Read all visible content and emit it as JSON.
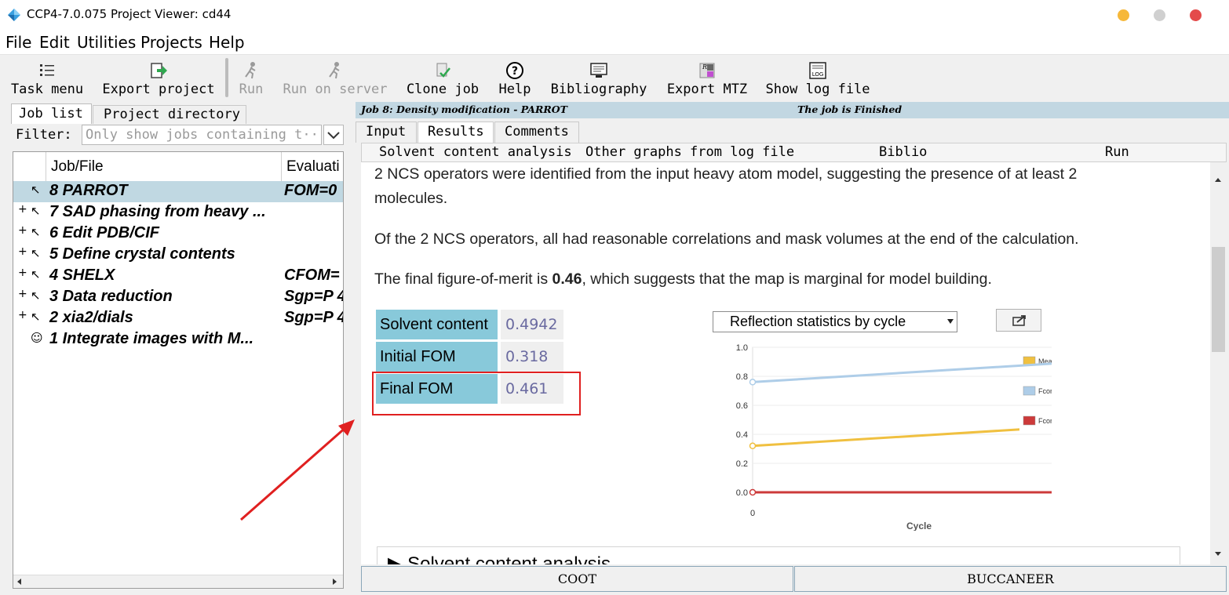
{
  "window": {
    "title": "CCP4-7.0.075 Project Viewer: cd44",
    "controls": {
      "minimize_color": "#f6b83a",
      "maximize_color": "#c8c8c8",
      "close_color": "#e44b4b"
    }
  },
  "menubar": [
    "File",
    "Edit",
    "Utilities",
    "Projects",
    "Help"
  ],
  "toolbar": {
    "items": [
      {
        "label": "Task menu",
        "icon": "task-menu-icon",
        "enabled": true
      },
      {
        "label": "Export project",
        "icon": "export-project-icon",
        "enabled": true
      },
      {
        "label": "Run",
        "icon": "run-icon",
        "enabled": false
      },
      {
        "label": "Run on server",
        "icon": "run-server-icon",
        "enabled": false
      },
      {
        "label": "Clone job",
        "icon": "clone-job-icon",
        "enabled": true
      },
      {
        "label": "Help",
        "icon": "help-icon",
        "enabled": true
      },
      {
        "label": "Bibliography",
        "icon": "bibliography-icon",
        "enabled": true
      },
      {
        "label": "Export MTZ",
        "icon": "export-mtz-icon",
        "enabled": true
      },
      {
        "label": "Show log file",
        "icon": "log-file-icon",
        "enabled": true
      }
    ]
  },
  "left": {
    "tabs": [
      "Job list",
      "Project directory"
    ],
    "filter_label": "Filter:",
    "filter_placeholder": "Only show jobs containing t···",
    "columns": [
      "Job/File",
      "Evaluati"
    ],
    "jobs": [
      {
        "label": "8 PARROT",
        "eval": "FOM=0",
        "selected": true,
        "expandable": false
      },
      {
        "label": "7 SAD phasing from heavy ...",
        "eval": "",
        "selected": false,
        "expandable": true
      },
      {
        "label": "6 Edit PDB/CIF",
        "eval": "",
        "selected": false,
        "expandable": true
      },
      {
        "label": "5 Define crystal contents",
        "eval": "",
        "selected": false,
        "expandable": true
      },
      {
        "label": "4 SHELX",
        "eval": "CFOM=",
        "selected": false,
        "expandable": true
      },
      {
        "label": "3 Data reduction",
        "eval": "Sgp=P 4",
        "selected": false,
        "expandable": true
      },
      {
        "label": "2 xia2/dials",
        "eval": "Sgp=P 4",
        "selected": false,
        "expandable": true
      },
      {
        "label": "1 Integrate images with M...",
        "eval": "",
        "selected": false,
        "expandable": false
      }
    ]
  },
  "job_header": {
    "title": "Job 8:  Density modification - PARROT",
    "status": "The job is Finished"
  },
  "right_tabs": [
    "Input",
    "Results",
    "Comments"
  ],
  "sub_tabs": [
    "Solvent content analysis",
    "Other graphs from log file",
    "Biblio",
    "Run"
  ],
  "report": {
    "para1_line1": "2 NCS operators were identified from the input heavy atom model, suggesting the presence of at least 2",
    "para1_line2": "molecules.",
    "para2": "Of the 2 NCS operators, all had reasonable correlations and mask volumes at the end of the calculation.",
    "para3_prefix": "The final figure-of-merit is ",
    "para3_value": "0.46",
    "para3_suffix": ", which suggests that the map is marginal for model building.",
    "stats": [
      {
        "key": "Solvent content",
        "value": "0.4942"
      },
      {
        "key": "Initial FOM",
        "value": "0.318"
      },
      {
        "key": "Final FOM",
        "value": "0.461"
      }
    ],
    "section_title": "▶  Solvent content analysis"
  },
  "graph": {
    "selector": "Reflection statistics by cycle"
  },
  "chart_data": {
    "type": "line",
    "x": [
      0,
      1
    ],
    "xlabel": "Cycle",
    "ylim": [
      0.0,
      1.0
    ],
    "yticks": [
      "1.0",
      "0.8",
      "0.6",
      "0.4",
      "0.2",
      "0.0"
    ],
    "xticks": [
      "0",
      "1"
    ],
    "series": [
      {
        "name": "Mean_FOM",
        "color": "#f0c040",
        "values": [
          0.32,
          0.46
        ]
      },
      {
        "name": "Fcorrel_work",
        "color": "#aecde8",
        "values": [
          0.76,
          0.9
        ]
      },
      {
        "name": "Fcorrel_free",
        "color": "#cc3a3a",
        "values": [
          0.0,
          0.0
        ]
      }
    ],
    "legend_position": "right"
  },
  "bottom_buttons": [
    "COOT",
    "BUCCANEER"
  ],
  "annotation": {
    "highlight_color": "#e02020"
  }
}
